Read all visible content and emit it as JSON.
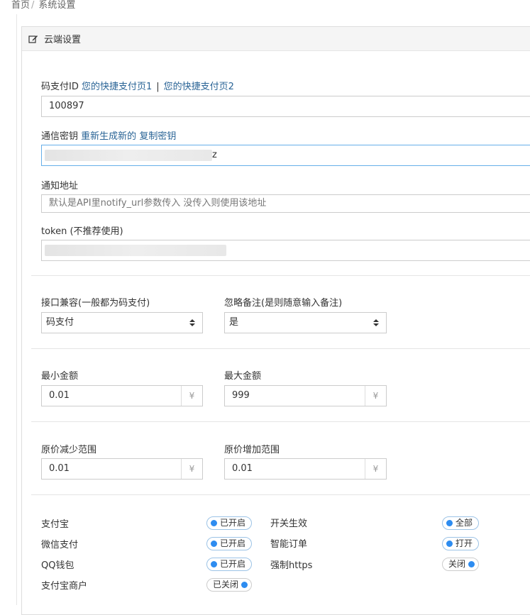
{
  "breadcrumb": {
    "home": "首页",
    "separator": "/",
    "current": "系统设置"
  },
  "panel": {
    "title": "云端设置",
    "icon": "edit-icon"
  },
  "pay_id": {
    "label": "码支付ID",
    "link1": "您的快捷支付页1",
    "divider": "|",
    "link2": "您的快捷支付页2",
    "value": "100897"
  },
  "secret": {
    "label": "通信密钥",
    "regen_link": "重新生成新的",
    "copy_link": "复制密钥",
    "visible_suffix": "z"
  },
  "notify": {
    "label": "通知地址",
    "placeholder": "默认是API里notify_url参数传入 没传入则使用该地址"
  },
  "token": {
    "label": "token (不推荐使用)"
  },
  "compat": {
    "label": "接口兼容(一般都为码支付)",
    "selected": "码支付"
  },
  "ignore_note": {
    "label": "忽略备注(是则随意输入备注)",
    "selected": "是"
  },
  "min_amount": {
    "label": "最小金额",
    "value": "0.01",
    "unit": "¥"
  },
  "max_amount": {
    "label": "最大金额",
    "value": "999",
    "unit": "¥"
  },
  "price_reduce": {
    "label": "原价减少范围",
    "value": "0.01",
    "unit": "¥"
  },
  "price_increase": {
    "label": "原价增加范围",
    "value": "0.01",
    "unit": "¥"
  },
  "switches_left": [
    {
      "label": "支付宝",
      "state": "已开启",
      "on": true
    },
    {
      "label": "微信支付",
      "state": "已开启",
      "on": true
    },
    {
      "label": "QQ钱包",
      "state": "已开启",
      "on": true
    },
    {
      "label": "支付宝商户",
      "state": "已关闭",
      "on": false
    }
  ],
  "switches_right": [
    {
      "label": "开关生效",
      "state": "全部",
      "on": true
    },
    {
      "label": "智能订单",
      "state": "打开",
      "on": true
    },
    {
      "label": "强制https",
      "state": "关闭",
      "on": false
    }
  ],
  "colors": {
    "link": "#2a6496",
    "toggle_dot": "#2d8cf0",
    "focus_border": "#66afe9"
  }
}
